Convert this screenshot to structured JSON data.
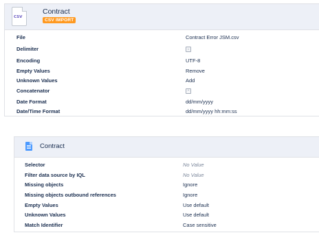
{
  "import": {
    "icon": "csv-file-icon",
    "icon_text": "CSV",
    "title": "Contract",
    "badge": "CSV IMPORT",
    "badge_color": "#ff991f",
    "fields": [
      {
        "label": "File",
        "value": "Contract Error JSM.csv"
      },
      {
        "label": "Delimiter",
        "value": ","
      },
      {
        "label": "Encoding",
        "value": "UTF-8"
      },
      {
        "label": "Empty Values",
        "value": "Remove"
      },
      {
        "label": "Unknown Values",
        "value": "Add"
      },
      {
        "label": "Concatenator",
        "value": "-"
      },
      {
        "label": "Date Format",
        "value": "dd/mm/yyyy"
      },
      {
        "label": "Date/Time Format",
        "value": "dd/mm/yyyy hh:mm:ss"
      }
    ]
  },
  "mapping": {
    "icon": "document-icon",
    "title": "Contract",
    "fields": [
      {
        "label": "Selector",
        "value": "No Value"
      },
      {
        "label": "Filter data source by IQL",
        "value": "No Value"
      },
      {
        "label": "Missing objects",
        "value": "Ignore"
      },
      {
        "label": "Missing objects outbound references",
        "value": "Ignore"
      },
      {
        "label": "Empty Values",
        "value": "Use default"
      },
      {
        "label": "Unknown Values",
        "value": "Use default"
      },
      {
        "label": "Match Identifier",
        "value": "Case sensitive"
      }
    ]
  }
}
